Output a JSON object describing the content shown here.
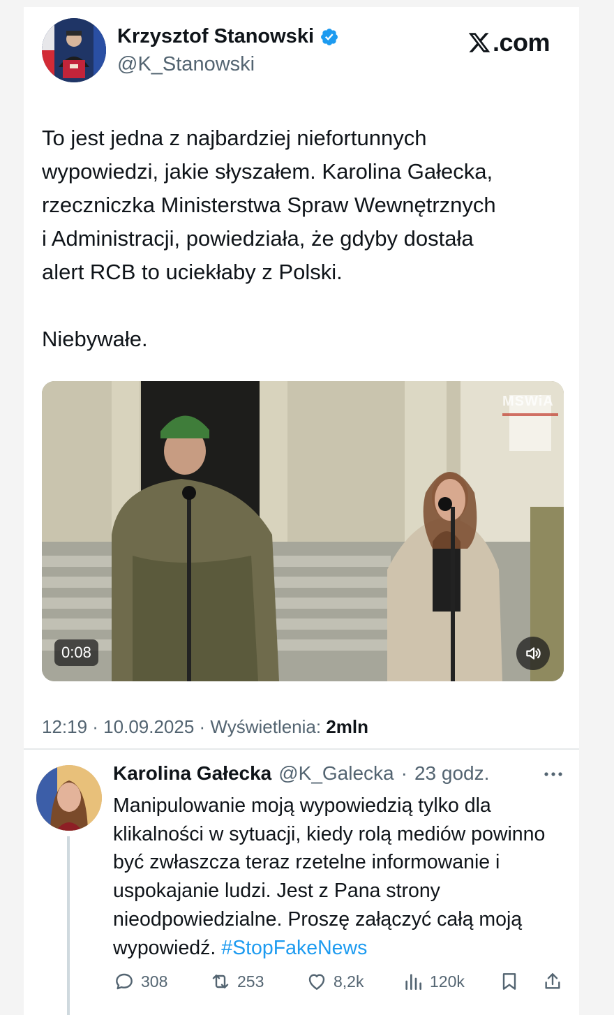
{
  "tweet": {
    "author_name": "Krzysztof Stanowski",
    "author_handle": "@K_Stanowski",
    "site_label": ".com",
    "text_paragraph_1": "To jest jedna z najbardziej niefortunnych\nwypowiedzi, jakie słyszałem. Karolina Gałecka,\nrzeczniczka Ministerstwa Spraw Wewnętrznych\ni Administracji, powiedziała, że gdyby dostała\nalert RCB to uciekłaby z Polski.",
    "text_paragraph_2": "Niebywałe.",
    "video": {
      "duration": "0:08",
      "watermark": "MSWiA"
    },
    "meta": {
      "time_date": "12:19 · 10.09.2025 · Wyświetlenia: ",
      "views": "2mln"
    }
  },
  "reply": {
    "author_name": "Karolina Gałecka",
    "author_handle": "@K_Galecka",
    "separator": "·",
    "time": "23 godz.",
    "text": "Manipulowanie moją wypowiedzią tylko dla klikalności w sytuacji, kiedy rolą mediów powinno być zwłaszcza teraz rzetelne informowanie i uspokajanie ludzi. Jest z Pana strony nieodpowiedzialne. Proszę załączyć całą moją wypowiedź.",
    "hashtag": "#StopFakeNews",
    "actions": {
      "replies": "308",
      "reposts": "253",
      "likes": "8,2k",
      "views": "120k"
    }
  },
  "icons": {
    "verified": "verified-badge-icon",
    "x_logo": "x-logo-icon",
    "volume": "volume-icon",
    "more": "more-icon",
    "reply": "reply-icon",
    "repost": "repost-icon",
    "like": "like-icon",
    "views": "views-icon",
    "bookmark": "bookmark-icon",
    "share": "share-icon"
  },
  "colors": {
    "link": "#1d9bf0",
    "secondary_text": "#536471",
    "verified": "#1d9bf0"
  }
}
